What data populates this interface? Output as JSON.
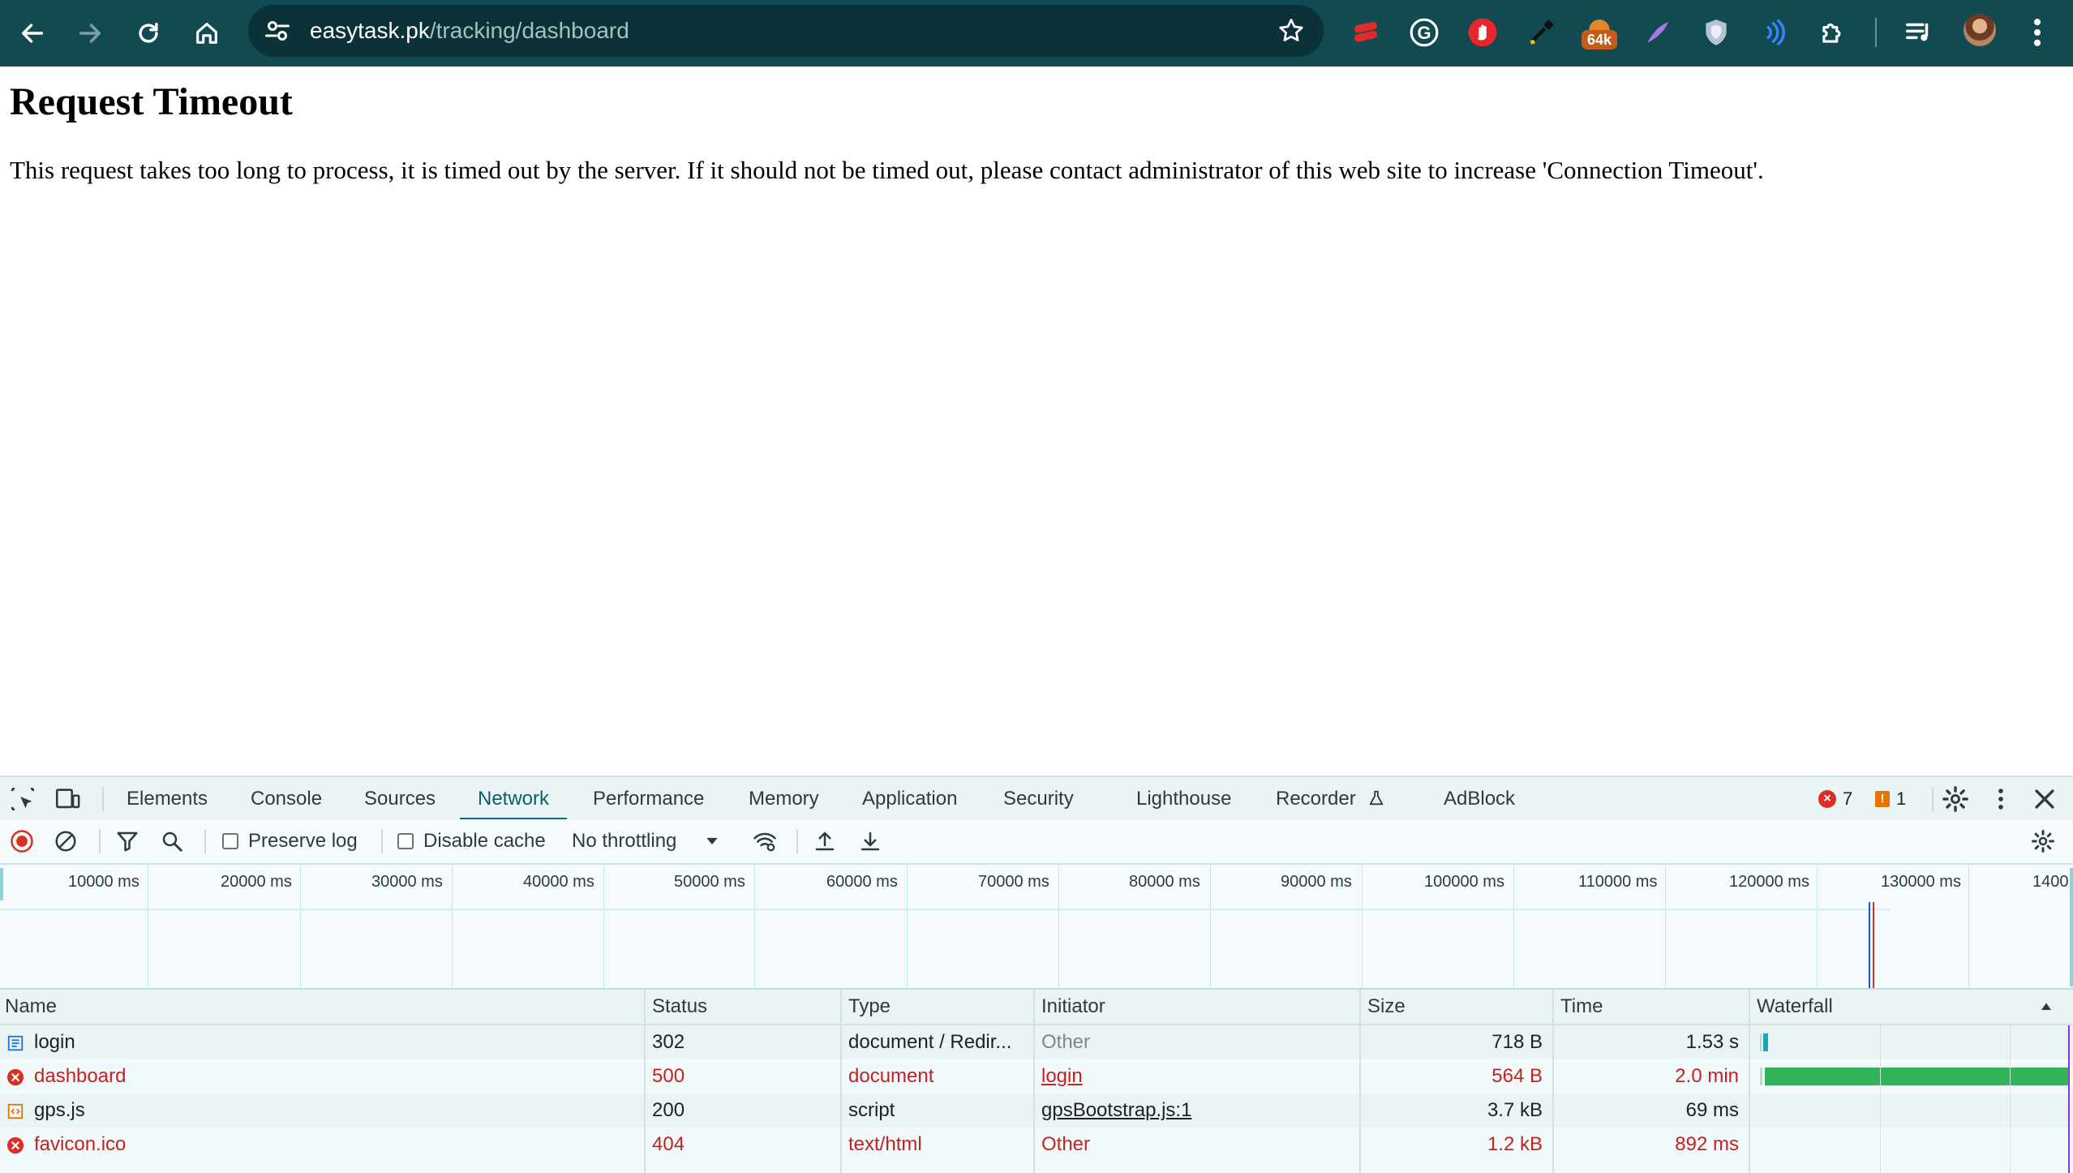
{
  "browser": {
    "url_host": "easytask.pk",
    "url_path": "/tracking/dashboard",
    "extension_badge": "64k",
    "colors": {
      "toolbar": "#124a52",
      "omnibox": "#0a3238"
    },
    "icons": [
      "back-icon",
      "forward-icon",
      "reload-icon",
      "home-icon",
      "site-info-icon",
      "bookmark-star-icon",
      "lastpass-icon",
      "grammarly-icon",
      "adblock-icon",
      "eyedropper-icon",
      "extension-64k-icon",
      "feather-icon",
      "shield-icon",
      "audio-icon",
      "puzzle-icon",
      "media-controls-icon",
      "profile-avatar",
      "menu-kebab-icon"
    ]
  },
  "page": {
    "heading": "Request Timeout",
    "message": "This request takes too long to process, it is timed out by the server. If it should not be timed out, please contact administrator of this web site to increase 'Connection Timeout'."
  },
  "devtools": {
    "tabs": [
      "Elements",
      "Console",
      "Sources",
      "Network",
      "Performance",
      "Memory",
      "Application",
      "Security",
      "Lighthouse",
      "Recorder",
      "AdBlock"
    ],
    "active_tab": "Network",
    "error_count": "7",
    "warning_count": "1",
    "controls": {
      "preserve_log": "Preserve log",
      "disable_cache": "Disable cache",
      "throttling": "No throttling"
    },
    "timeline_ticks": [
      "10000 ms",
      "20000 ms",
      "30000 ms",
      "40000 ms",
      "50000 ms",
      "60000 ms",
      "70000 ms",
      "80000 ms",
      "90000 ms",
      "100000 ms",
      "110000 ms",
      "120000 ms",
      "130000 ms",
      "1400"
    ],
    "columns": [
      "Name",
      "Status",
      "Type",
      "Initiator",
      "Size",
      "Time",
      "Waterfall"
    ],
    "rows": [
      {
        "name": "login",
        "status": "302",
        "type": "document / Redir...",
        "initiator": "Other",
        "size": "718 B",
        "time": "1.53 s",
        "icon": "document-icon",
        "error": false
      },
      {
        "name": "dashboard",
        "status": "500",
        "type": "document",
        "initiator": "login",
        "size": "564 B",
        "time": "2.0 min",
        "icon": "error-icon",
        "error": true
      },
      {
        "name": "gps.js",
        "status": "200",
        "type": "script",
        "initiator": "gpsBootstrap.js:1",
        "size": "3.7 kB",
        "time": "69 ms",
        "icon": "script-icon",
        "error": false
      },
      {
        "name": "favicon.ico",
        "status": "404",
        "type": "text/html",
        "initiator": "Other",
        "size": "1.2 kB",
        "time": "892 ms",
        "icon": "error-icon",
        "error": true
      }
    ]
  }
}
